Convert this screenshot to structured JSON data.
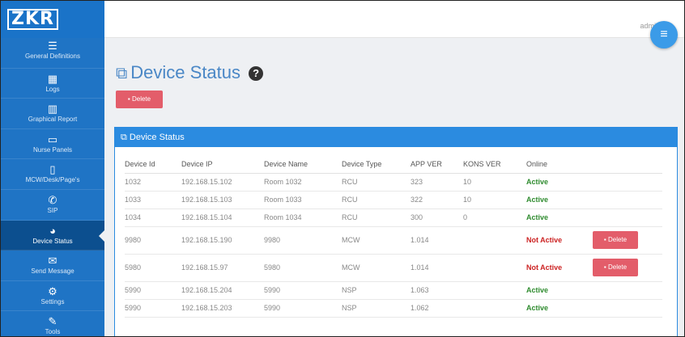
{
  "app": {
    "logo": "ZKR",
    "user": "admin"
  },
  "sidebar": {
    "items": [
      {
        "icon": "☰",
        "label": "General Definitions"
      },
      {
        "icon": "▦",
        "label": "Logs"
      },
      {
        "icon": "▥",
        "label": "Graphical Report"
      },
      {
        "icon": "▭",
        "label": "Nurse Panels"
      },
      {
        "icon": "▯",
        "label": "MCW/Desk/Page's"
      },
      {
        "icon": "✆",
        "label": "SIP"
      },
      {
        "icon": "◕",
        "label": "Device Status"
      },
      {
        "icon": "✉",
        "label": "Send Message"
      },
      {
        "icon": "⚙",
        "label": "Settings"
      },
      {
        "icon": "✎",
        "label": "Tools"
      }
    ]
  },
  "page": {
    "title": "Device Status",
    "delete_label": "Delete"
  },
  "panel": {
    "title": "Device Status"
  },
  "table": {
    "columns": [
      "Device Id",
      "Device IP",
      "Device Name",
      "Device Type",
      "APP VER",
      "KONS VER",
      "Online"
    ],
    "rows": [
      {
        "id": "1032",
        "ip": "192.168.15.102",
        "name": "Room 1032",
        "type": "RCU",
        "app": "323",
        "kons": "10",
        "online": "Active",
        "delete": ""
      },
      {
        "id": "1033",
        "ip": "192.168.15.103",
        "name": "Room 1033",
        "type": "RCU",
        "app": "322",
        "kons": "10",
        "online": "Active",
        "delete": ""
      },
      {
        "id": "1034",
        "ip": "192.168.15.104",
        "name": "Room 1034",
        "type": "RCU",
        "app": "300",
        "kons": "0",
        "online": "Active",
        "delete": ""
      },
      {
        "id": "9980",
        "ip": "192.168.15.190",
        "name": "9980",
        "type": "MCW",
        "app": "1.014",
        "kons": "",
        "online": "Not Active",
        "delete": "Delete"
      },
      {
        "id": "5980",
        "ip": "192.168.15.97",
        "name": "5980",
        "type": "MCW",
        "app": "1.014",
        "kons": "",
        "online": "Not Active",
        "delete": "Delete"
      },
      {
        "id": "5990",
        "ip": "192.168.15.204",
        "name": "5990",
        "type": "NSP",
        "app": "1.063",
        "kons": "",
        "online": "Active",
        "delete": ""
      },
      {
        "id": "5990",
        "ip": "192.168.15.203",
        "name": "5990",
        "type": "NSP",
        "app": "1.062",
        "kons": "",
        "online": "Active",
        "delete": ""
      }
    ]
  },
  "colors": {
    "sidebar": "#1f74c5",
    "sidebar_active": "#0c4f8f",
    "accent": "#2b8be0",
    "danger": "#e35d6a",
    "active": "#2e8b2e",
    "not_active": "#cc2222"
  }
}
